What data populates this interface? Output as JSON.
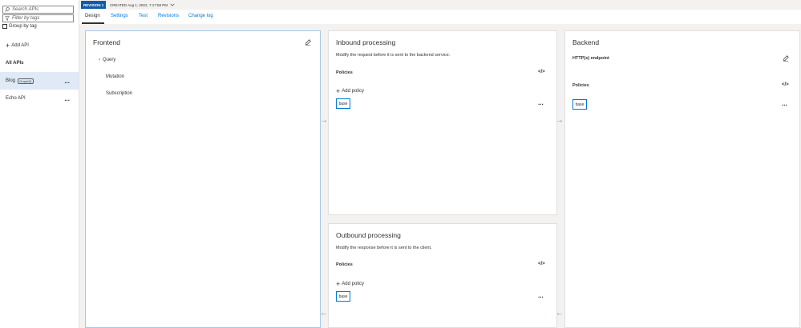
{
  "sidebar": {
    "search_placeholder": "Search APIs",
    "filter_placeholder": "Filter by tags",
    "group_by_tag": "Group by tag",
    "add_api": "Add API",
    "all_apis": "All APIs",
    "apis": [
      {
        "name": "Blog",
        "tag": "GraphQL"
      },
      {
        "name": "Echo API",
        "tag": ""
      }
    ]
  },
  "revision": {
    "badge": "REVISION 1",
    "created": "CREATED Aug 1, 2022, 7:17:58 PM"
  },
  "tabs": [
    "Design",
    "Settings",
    "Test",
    "Revisions",
    "Change log"
  ],
  "frontend": {
    "title": "Frontend",
    "items": [
      "Query",
      "Mutation",
      "Subscription"
    ]
  },
  "inbound": {
    "title": "Inbound processing",
    "subtitle": "Modify the request before it is sent to the backend service.",
    "policies_label": "Policies",
    "add_policy": "Add policy",
    "base": "base"
  },
  "outbound": {
    "title": "Outbound processing",
    "subtitle": "Modify the response before it is sent to the client.",
    "policies_label": "Policies",
    "add_policy": "Add policy",
    "base": "base"
  },
  "backend": {
    "title": "Backend",
    "endpoint_label": "HTTP(s) endpoint",
    "policies_label": "Policies",
    "base": "base"
  },
  "icons": {
    "code": "</>",
    "more": "...",
    "plus": "+"
  },
  "colors": {
    "accent": "#0078d4",
    "revision_badge": "#0f5ca8",
    "selected_bg": "#dfeaf6"
  }
}
